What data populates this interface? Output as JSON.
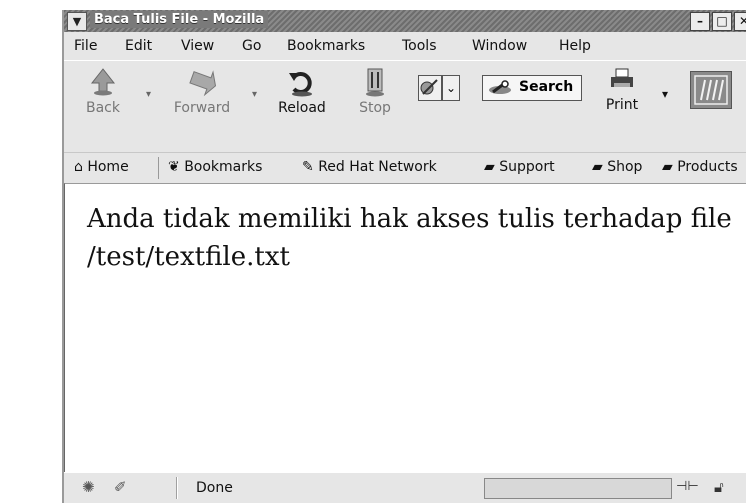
{
  "window": {
    "title": "Baca Tulis File - Mozilla",
    "controls": {
      "minimize": "–",
      "maximize": "□",
      "close": "✕"
    }
  },
  "menubar": {
    "items": [
      {
        "label": "File"
      },
      {
        "label": "Edit"
      },
      {
        "label": "View"
      },
      {
        "label": "Go"
      },
      {
        "label": "Bookmarks"
      },
      {
        "label": "Tools"
      },
      {
        "label": "Window"
      },
      {
        "label": "Help"
      }
    ]
  },
  "toolbar": {
    "back": "Back",
    "forward": "Forward",
    "reload": "Reload",
    "stop": "Stop",
    "search": "Search",
    "print": "Print"
  },
  "bookmarks_toolbar": {
    "items": [
      {
        "label": "Home",
        "icon": "home-icon"
      },
      {
        "label": "Bookmarks",
        "icon": "bookmarks-icon"
      },
      {
        "label": "Red Hat Network",
        "icon": "redhat-network-icon"
      },
      {
        "label": "Support",
        "icon": "folder-icon"
      },
      {
        "label": "Shop",
        "icon": "folder-icon"
      },
      {
        "label": "Products",
        "icon": "folder-icon"
      }
    ]
  },
  "content": {
    "message": "Anda tidak memiliki hak akses tulis terhadap file /test/textfile.txt"
  },
  "statusbar": {
    "status": "Done"
  }
}
